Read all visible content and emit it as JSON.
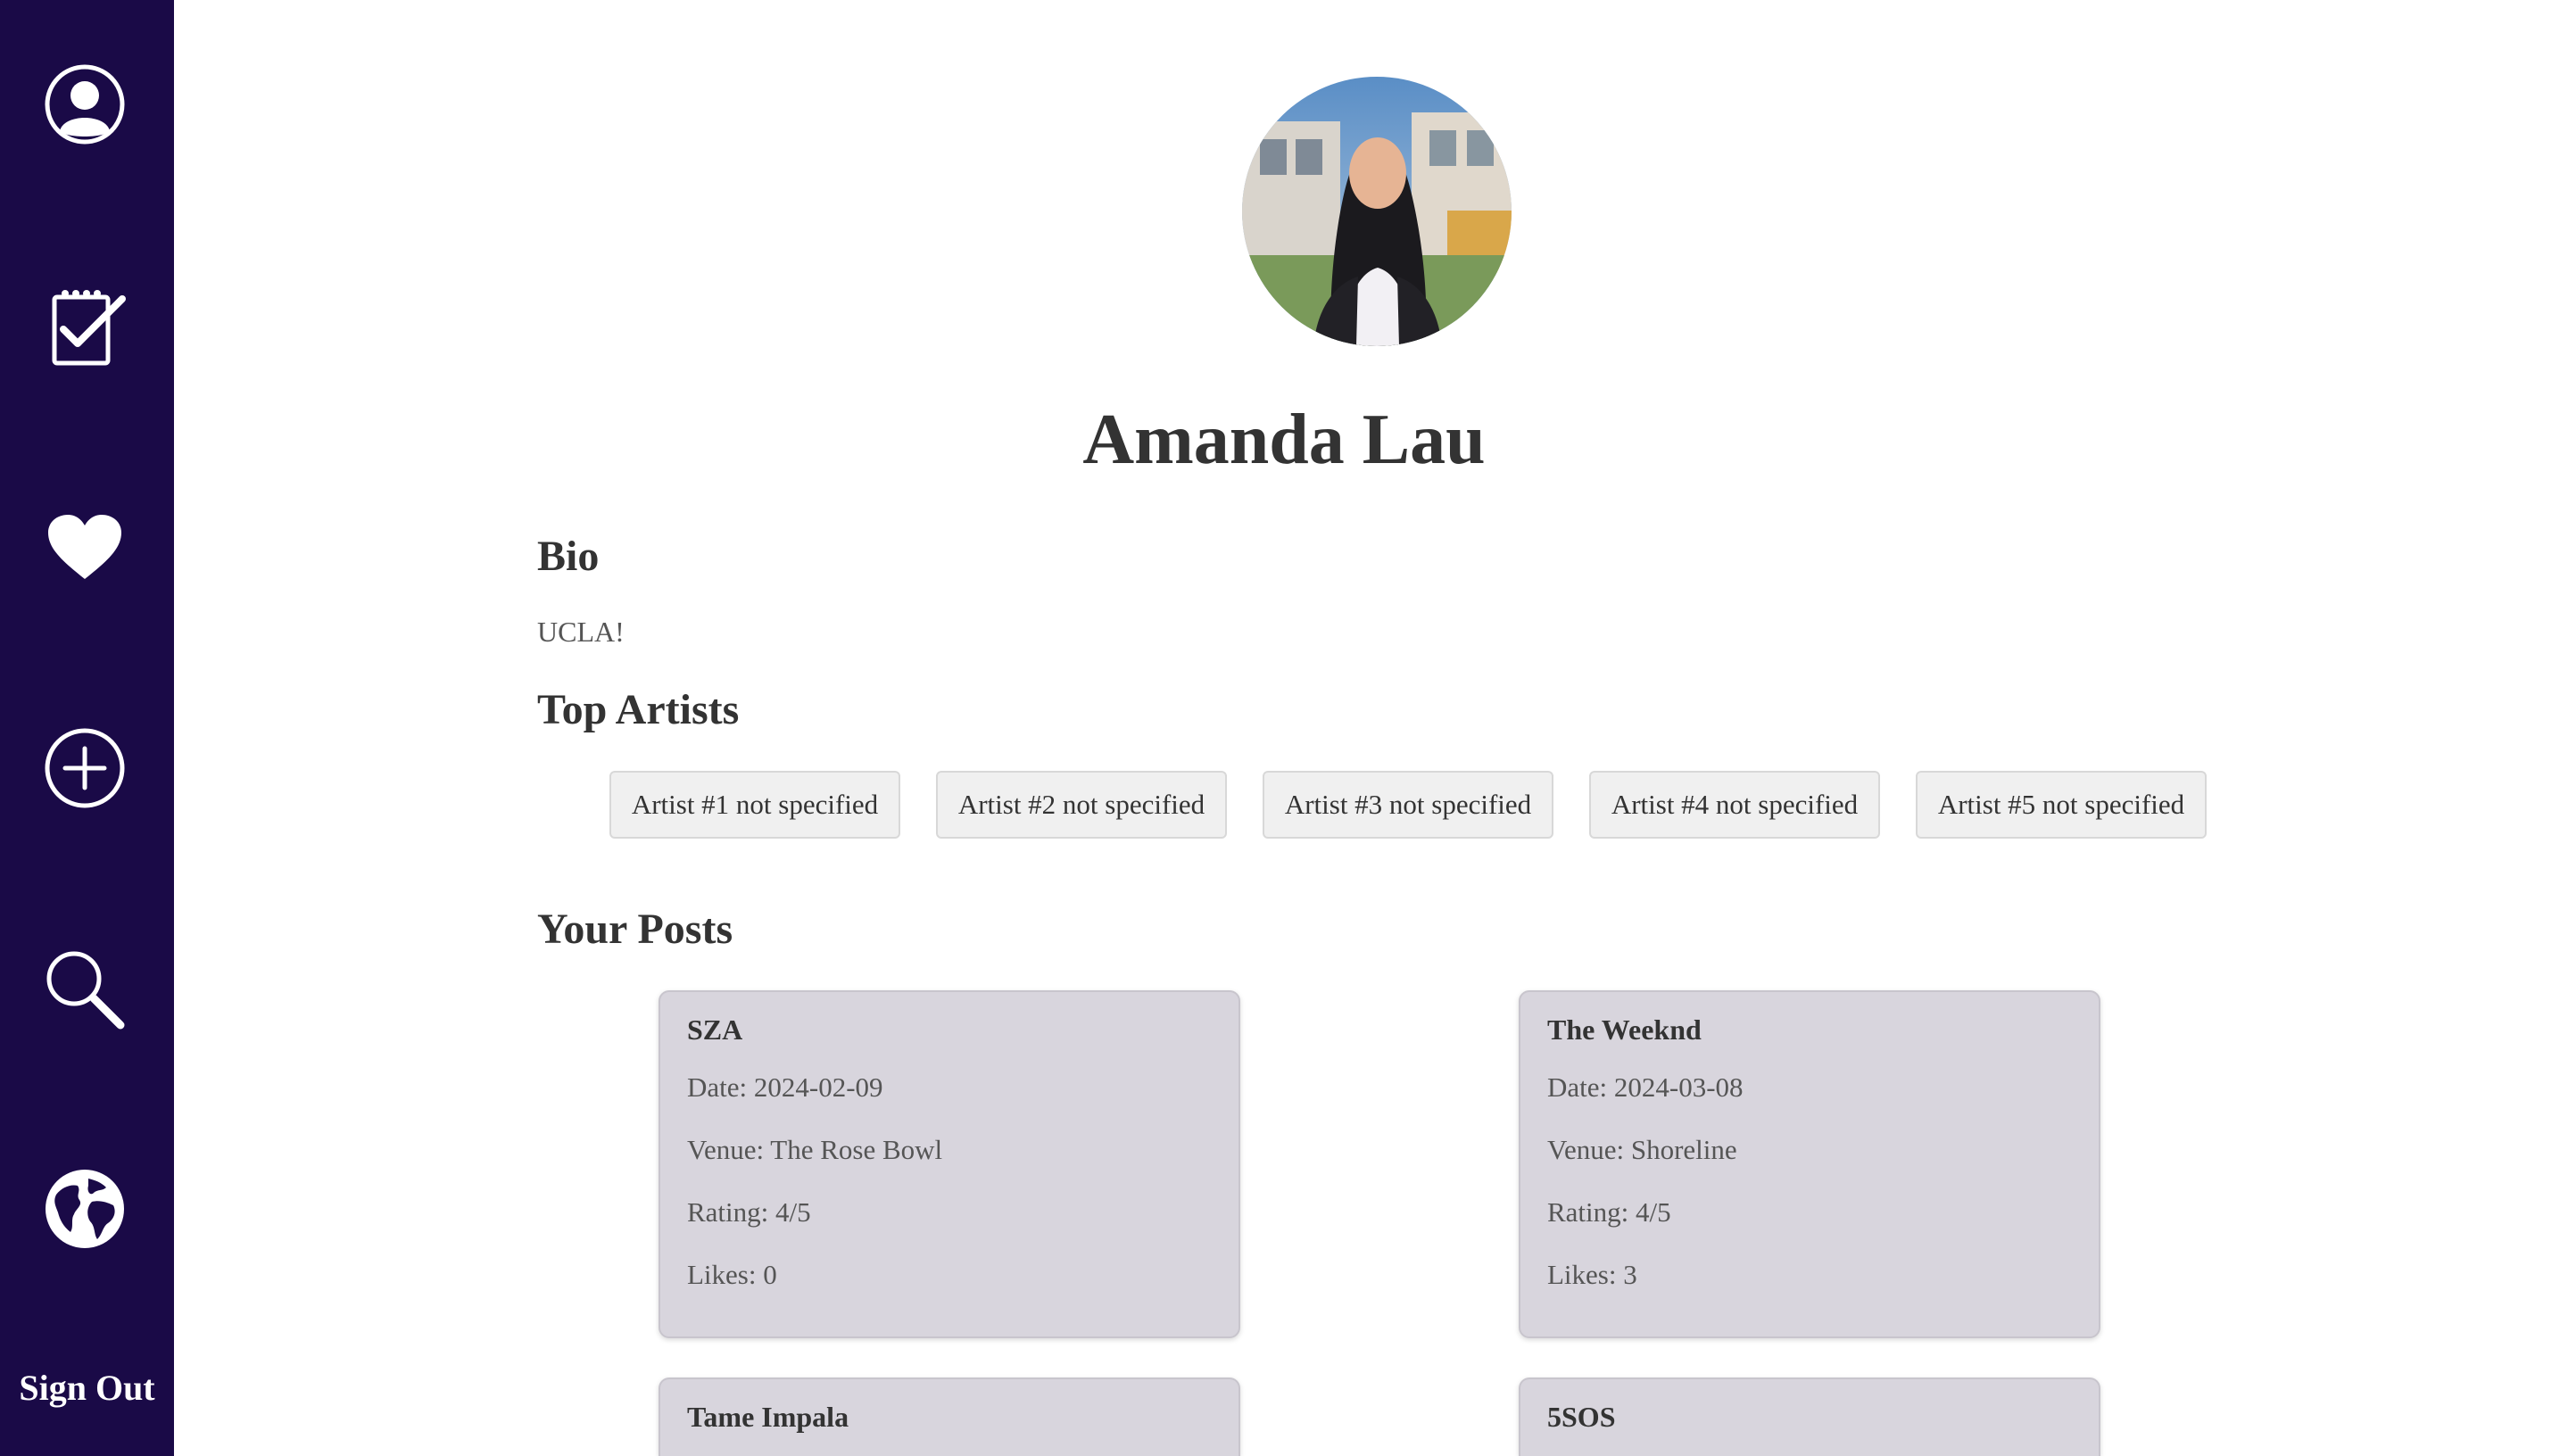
{
  "sidebar": {
    "items": [
      {
        "icon": "profile-icon"
      },
      {
        "icon": "checklist-icon"
      },
      {
        "icon": "heart-icon"
      },
      {
        "icon": "add-icon"
      },
      {
        "icon": "search-icon"
      },
      {
        "icon": "globe-icon"
      }
    ],
    "sign_out": "Sign Out",
    "background": "#1a0a47"
  },
  "profile": {
    "name": "Amanda Lau",
    "bio_heading": "Bio",
    "bio": "UCLA!",
    "top_artists_heading": "Top Artists",
    "top_artists": [
      "Artist #1 not specified",
      "Artist #2 not specified",
      "Artist #3 not specified",
      "Artist #4 not specified",
      "Artist #5 not specified"
    ],
    "posts_heading": "Your Posts"
  },
  "posts": [
    {
      "title": "SZA",
      "date": "Date: 2024-02-09",
      "venue": "Venue: The Rose Bowl",
      "rating": "Rating: 4/5",
      "likes": "Likes: 0"
    },
    {
      "title": "The Weeknd",
      "date": "Date: 2024-03-08",
      "venue": "Venue: Shoreline",
      "rating": "Rating: 4/5",
      "likes": "Likes: 3"
    },
    {
      "title": "Tame Impala"
    },
    {
      "title": "5SOS"
    }
  ]
}
